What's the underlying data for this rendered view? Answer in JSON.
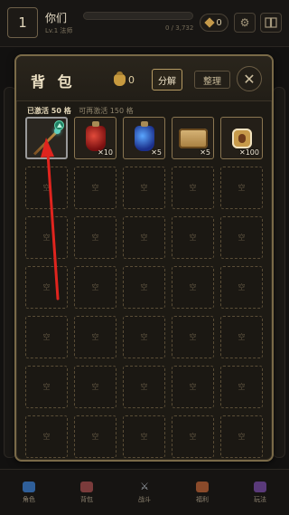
{
  "player": {
    "level": "1",
    "name": "你们",
    "sub": "Lv.1 法师",
    "exp_text": "0 / 3,732",
    "exp_progress": 0.0
  },
  "currency": {
    "diamonds": "0"
  },
  "topbar_icons": {
    "settings": "gear-icon",
    "book": "book-icon"
  },
  "bag": {
    "title": "背 包",
    "gold": "0",
    "decompose_label": "分解",
    "sort_label": "整理",
    "close_glyph": "✕",
    "capacity_active": "已激活 50 格",
    "capacity_more": "可再激活 150 格",
    "empty_label": "空",
    "items": [
      {
        "name": "法杖",
        "icon": "staff-icon",
        "qty": "",
        "equipped": true
      },
      {
        "name": "红色药水",
        "icon": "red-potion-icon",
        "qty": "✕10",
        "equipped": false
      },
      {
        "name": "蓝色药水",
        "icon": "blue-potion-icon",
        "qty": "✕5",
        "equipped": false
      },
      {
        "name": "卷轴",
        "icon": "scroll-icon",
        "qty": "✕5",
        "equipped": false
      },
      {
        "name": "钱袋",
        "icon": "pouch-icon",
        "qty": "✕100",
        "equipped": false
      }
    ],
    "visible_empty_slots": 30
  },
  "nav": [
    {
      "label": "角色",
      "icon": "character-icon"
    },
    {
      "label": "背包",
      "icon": "backpack-icon"
    },
    {
      "label": "战斗",
      "icon": "swords-icon"
    },
    {
      "label": "福利",
      "icon": "gift-icon"
    },
    {
      "label": "玩法",
      "icon": "books-icon"
    }
  ],
  "colors": {
    "accent_gold": "#c79a4a",
    "annotation_red": "#e0241e"
  }
}
